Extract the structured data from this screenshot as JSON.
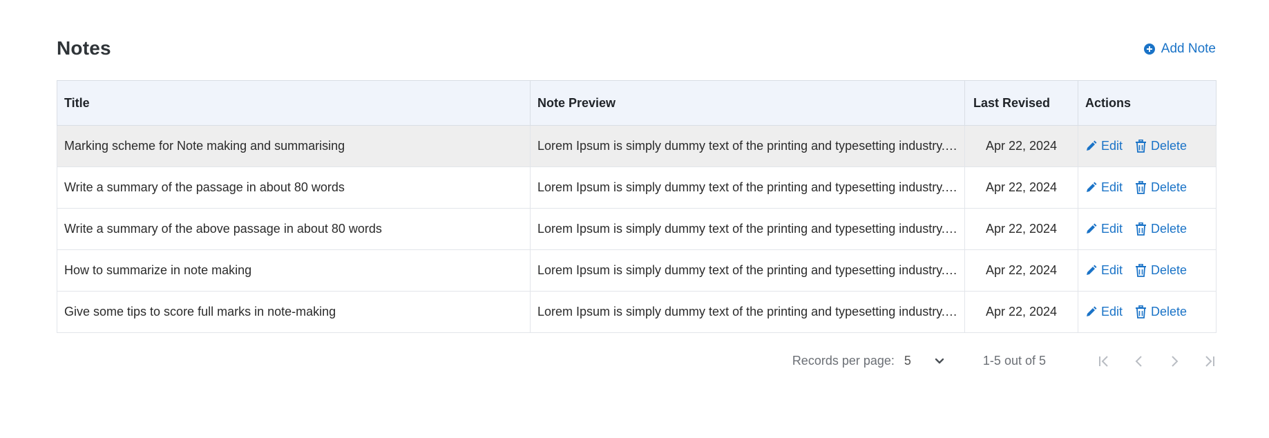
{
  "header": {
    "title": "Notes",
    "add_note_label": "Add Note"
  },
  "table": {
    "columns": [
      "Title",
      "Note Preview",
      "Last Revised",
      "Actions"
    ],
    "rows": [
      {
        "title": "Marking scheme for Note making and summarising",
        "preview": "Lorem Ipsum is simply dummy text of the printing and typesetting industry. Lorem Ipsum has been the industry's standard dummy text.",
        "date": "Apr 22, 2024",
        "edit_label": "Edit",
        "delete_label": "Delete"
      },
      {
        "title": "Write a summary of the passage in about 80 words",
        "preview": "Lorem Ipsum is simply dummy text of the printing and typesetting industry. Lorem Ipsum has been the industry's standard dummy text.",
        "date": "Apr 22, 2024",
        "edit_label": "Edit",
        "delete_label": "Delete"
      },
      {
        "title": "Write a summary of the above passage in about 80 words",
        "preview": "Lorem Ipsum is simply dummy text of the printing and typesetting industry. Lorem Ipsum has been the industry's standard dummy text.",
        "date": "Apr 22, 2024",
        "edit_label": "Edit",
        "delete_label": "Delete"
      },
      {
        "title": "How to summarize in note making",
        "preview": "Lorem Ipsum is simply dummy text of the printing and typesetting industry. Lorem Ipsum has been the industry's standard dummy text.",
        "date": "Apr 22, 2024",
        "edit_label": "Edit",
        "delete_label": "Delete"
      },
      {
        "title": "Give some tips to score full marks in note-making",
        "preview": "Lorem Ipsum is simply dummy text of the printing and typesetting industry. Lorem Ipsum has been the industry's standard dummy text.",
        "date": "Apr 22, 2024",
        "edit_label": "Edit",
        "delete_label": "Delete"
      }
    ]
  },
  "pagination": {
    "records_label": "Records per page:",
    "records_value": "5",
    "range_text": "1-5 out of 5"
  },
  "icons": {
    "add": "plus-circle-icon",
    "edit": "pencil-icon",
    "delete": "trash-icon",
    "dropdown": "chevron-down-icon",
    "first": "first-page-icon",
    "prev": "chevron-left-icon",
    "next": "chevron-right-icon",
    "last": "last-page-icon"
  },
  "colors": {
    "accent": "#1a73c7",
    "header_bg": "#f0f4fb",
    "highlight_row": "#eeeeee"
  }
}
